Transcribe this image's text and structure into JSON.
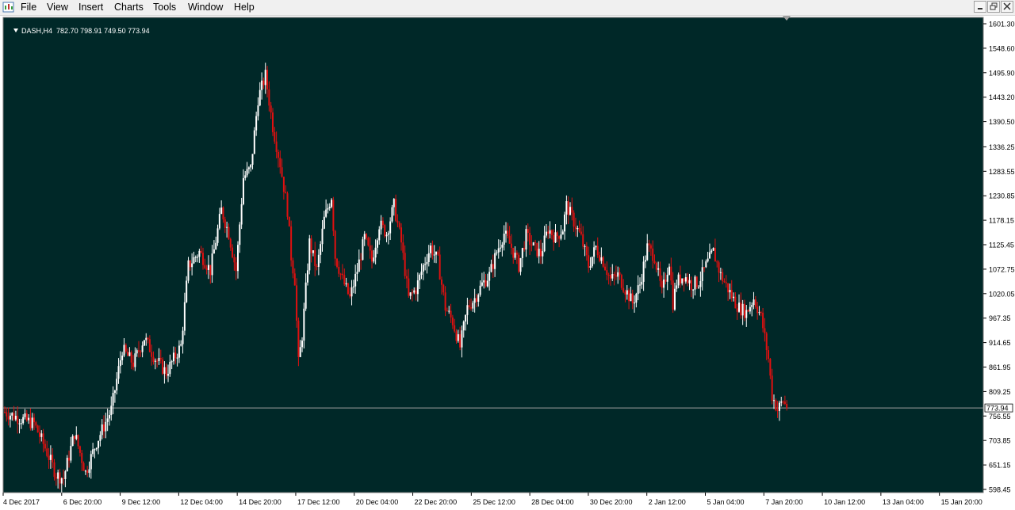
{
  "app": {
    "menu": [
      "File",
      "View",
      "Insert",
      "Charts",
      "Tools",
      "Window",
      "Help"
    ],
    "window_controls": [
      "minimize-icon",
      "restore-icon",
      "close-icon"
    ]
  },
  "chart_header": {
    "symbol": "DASH,H4",
    "ohlc": "782.70 798.91 749.50 773.94"
  },
  "colors": {
    "background": "#002828",
    "bull": "#ffffff",
    "bear": "#e01010",
    "grid_line": "#a0a0a0",
    "axis_bg": "#ffffff"
  },
  "chart_data": {
    "type": "candlestick",
    "title": "DASH,H4",
    "timeframe": "H4",
    "current_price": 773.94,
    "ylim": [
      598.46,
      1601.3
    ],
    "y_ticks": [
      "1601.30",
      "1548.60",
      "1495.90",
      "1443.20",
      "1390.50",
      "1336.25",
      "1283.55",
      "1230.85",
      "1178.15",
      "1125.45",
      "1072.75",
      "1020.05",
      "967.35",
      "914.65",
      "861.95",
      "809.25",
      "756.55",
      "703.85",
      "651.15",
      "598.45"
    ],
    "x_ticks": [
      "4 Dec 2017",
      "6 Dec 20:00",
      "9 Dec 12:00",
      "12 Dec 04:00",
      "14 Dec 20:00",
      "17 Dec 12:00",
      "20 Dec 04:00",
      "22 Dec 20:00",
      "25 Dec 12:00",
      "28 Dec 04:00",
      "30 Dec 20:00",
      "2 Jan 12:00",
      "5 Jan 04:00",
      "7 Jan 20:00",
      "10 Jan 12:00",
      "13 Jan 04:00",
      "15 Jan 20:00"
    ],
    "close_path": [
      [
        0,
        765
      ],
      [
        8,
        752
      ],
      [
        16,
        740
      ],
      [
        22,
        688
      ],
      [
        28,
        630
      ],
      [
        32,
        622
      ],
      [
        38,
        720
      ],
      [
        44,
        635
      ],
      [
        50,
        700
      ],
      [
        58,
        770
      ],
      [
        64,
        900
      ],
      [
        70,
        870
      ],
      [
        76,
        925
      ],
      [
        82,
        880
      ],
      [
        88,
        850
      ],
      [
        96,
        908
      ],
      [
        100,
        1080
      ],
      [
        106,
        1110
      ],
      [
        112,
        1070
      ],
      [
        118,
        1200
      ],
      [
        122,
        1150
      ],
      [
        126,
        1070
      ],
      [
        130,
        1270
      ],
      [
        134,
        1290
      ],
      [
        138,
        1440
      ],
      [
        142,
        1490
      ],
      [
        146,
        1380
      ],
      [
        150,
        1300
      ],
      [
        154,
        1200
      ],
      [
        156,
        1100
      ],
      [
        158,
        1050
      ],
      [
        160,
        870
      ],
      [
        162,
        930
      ],
      [
        166,
        1130
      ],
      [
        170,
        1070
      ],
      [
        174,
        1180
      ],
      [
        178,
        1230
      ],
      [
        180,
        1100
      ],
      [
        184,
        1050
      ],
      [
        188,
        1010
      ],
      [
        192,
        1070
      ],
      [
        196,
        1140
      ],
      [
        200,
        1090
      ],
      [
        204,
        1170
      ],
      [
        208,
        1150
      ],
      [
        212,
        1210
      ],
      [
        216,
        1130
      ],
      [
        220,
        1010
      ],
      [
        224,
        1030
      ],
      [
        228,
        1080
      ],
      [
        232,
        1120
      ],
      [
        236,
        1090
      ],
      [
        240,
        990
      ],
      [
        244,
        960
      ],
      [
        248,
        905
      ],
      [
        252,
        990
      ],
      [
        256,
        1010
      ],
      [
        260,
        1040
      ],
      [
        264,
        1060
      ],
      [
        268,
        1110
      ],
      [
        272,
        1150
      ],
      [
        276,
        1120
      ],
      [
        280,
        1080
      ],
      [
        284,
        1145
      ],
      [
        288,
        1120
      ],
      [
        292,
        1105
      ],
      [
        296,
        1160
      ],
      [
        300,
        1140
      ],
      [
        304,
        1160
      ],
      [
        306,
        1210
      ],
      [
        310,
        1175
      ],
      [
        314,
        1140
      ],
      [
        318,
        1080
      ],
      [
        322,
        1120
      ],
      [
        326,
        1090
      ],
      [
        330,
        1050
      ],
      [
        334,
        1060
      ],
      [
        338,
        1030
      ],
      [
        342,
        1000
      ],
      [
        346,
        1040
      ],
      [
        350,
        1120
      ],
      [
        354,
        1100
      ],
      [
        358,
        1020
      ],
      [
        362,
        1090
      ],
      [
        364,
        1000
      ],
      [
        366,
        1045
      ],
      [
        370,
        1060
      ],
      [
        374,
        1040
      ],
      [
        378,
        1045
      ],
      [
        382,
        1080
      ],
      [
        386,
        1110
      ],
      [
        390,
        1060
      ],
      [
        394,
        1030
      ],
      [
        398,
        1000
      ],
      [
        400,
        990
      ],
      [
        404,
        980
      ],
      [
        408,
        1010
      ],
      [
        412,
        970
      ],
      [
        416,
        880
      ],
      [
        418,
        800
      ],
      [
        421,
        770
      ],
      [
        424,
        790
      ],
      [
        426,
        773.94
      ]
    ]
  }
}
